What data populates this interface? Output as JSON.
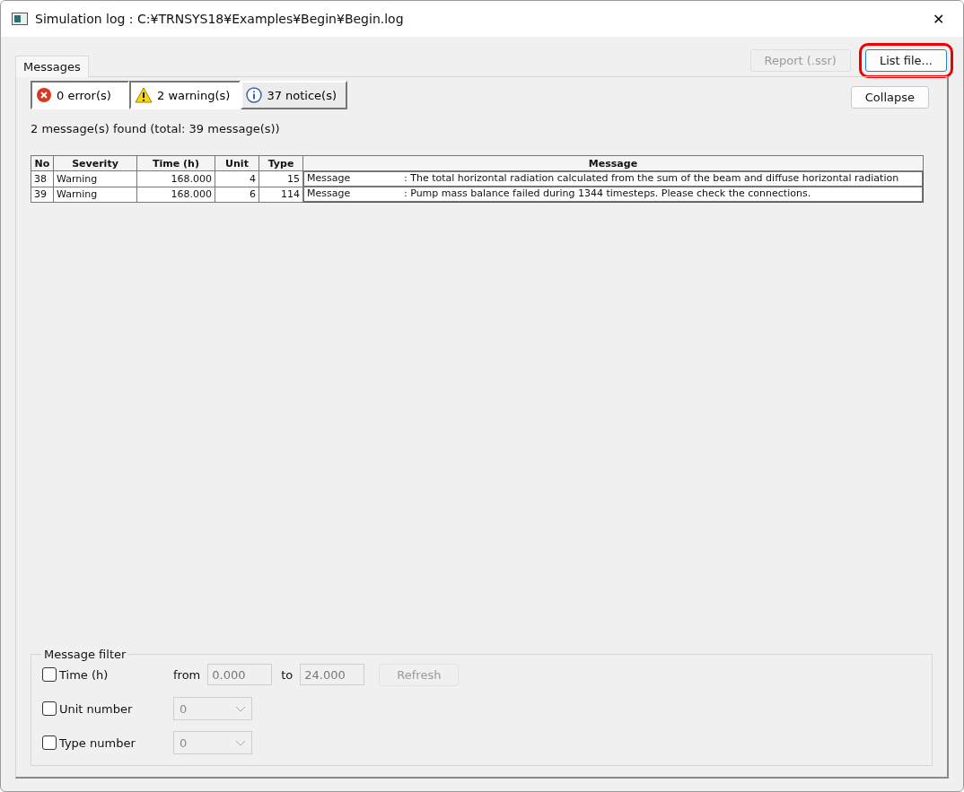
{
  "window": {
    "title": "Simulation log : C:¥TRNSYS18¥Examples¥Begin¥Begin.log",
    "close": "✕"
  },
  "tabs": [
    {
      "label": "Messages",
      "selected": true
    }
  ],
  "top_buttons": [
    {
      "label": "Report (.ssr)",
      "disabled": true,
      "highlighted": false
    },
    {
      "label": "List file...",
      "disabled": false,
      "highlighted": true
    }
  ],
  "severity_filters": [
    {
      "kind": "error",
      "label": "0 error(s)",
      "selected": true
    },
    {
      "kind": "warning",
      "label": "2 warning(s)",
      "selected": true
    },
    {
      "kind": "notice",
      "label": "37 notice(s)",
      "selected": false
    }
  ],
  "collapse_button": "Collapse",
  "summary": "2 message(s) found (total: 39 message(s))",
  "table": {
    "columns": [
      "No",
      "Severity",
      "Time (h)",
      "Unit",
      "Type",
      "Message"
    ],
    "rows": [
      {
        "no": "38",
        "severity": "Warning",
        "time": "168.000",
        "unit": "4",
        "type": "15",
        "category": "Message",
        "message": ": The total horizontal radiation calculated from the sum of the beam and diffuse horizontal radiation"
      },
      {
        "no": "39",
        "severity": "Warning",
        "time": "168.000",
        "unit": "6",
        "type": "114",
        "category": "Message",
        "message": ": Pump mass balance failed during 1344 timesteps. Please check the connections."
      }
    ]
  },
  "filter": {
    "title": "Message filter",
    "time": {
      "label": "Time (h)",
      "checked": false,
      "from_label": "from",
      "from": "0.000",
      "to_label": "to",
      "to": "24.000",
      "refresh": "Refresh"
    },
    "unit": {
      "label": "Unit number",
      "checked": false,
      "value": "0"
    },
    "type": {
      "label": "Type number",
      "checked": false,
      "value": "0"
    }
  }
}
